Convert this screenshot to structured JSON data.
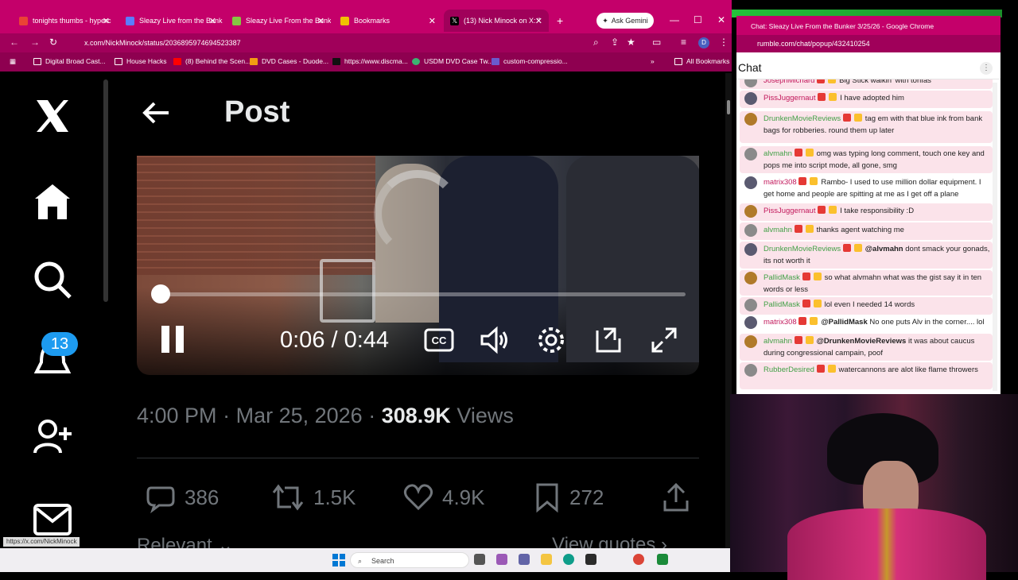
{
  "browser": {
    "tabs": [
      {
        "label": "tonights thumbs - hyperc",
        "color": "#ea4335"
      },
      {
        "label": "Sleazy Live from the Bunk",
        "color": "#5b7cff"
      },
      {
        "label": "Sleazy Live From the Bunk",
        "color": "#85c742"
      },
      {
        "label": "Bookmarks",
        "color": "#f0c000"
      },
      {
        "label": "(13) Nick Minock on X: \" ‪",
        "color": "#000000"
      }
    ],
    "ask_gemini": "Ask Gemini",
    "url": "x.com/NickMinock/status/2036895974694523387",
    "bookmarks": [
      "Digital Broad Cast...",
      "House Hacks",
      "(8) Behind the Scen...",
      "DVD Cases - Duode...",
      "https://www.discma...",
      "USDM DVD Case Tw...",
      "custom-compressio..."
    ],
    "all_bookmarks": "All Bookmarks",
    "status_url": "https://x.com/NickMinock"
  },
  "x": {
    "notifications_count": "13",
    "page_title": "Post",
    "video": {
      "time": "0:06 / 0:44",
      "progress": 0.14
    },
    "meta": {
      "time": "4:00 PM",
      "sep1": "·",
      "date": "Mar 25, 2026",
      "sep2": "·",
      "views": "308.9K",
      "views_label": "Views"
    },
    "actions": {
      "replies": "386",
      "reposts": "1.5K",
      "likes": "4.9K",
      "bookmarks": "272"
    },
    "relevant": "Relevant ⌄",
    "view_quotes": "View quotes ›"
  },
  "taskbar": {
    "search_placeholder": "Search"
  },
  "chat": {
    "window_title": "Chat: Sleazy Live From the Bunker 3/25/26 - Google Chrome",
    "url": "rumble.com/chat/popup/432410254",
    "title": "Chat",
    "messages": [
      {
        "user": "JosephMichard",
        "text": "Big Stick walkin' with tonfas",
        "user_color": "#c2185b",
        "highlight": true
      },
      {
        "user": "PissJuggernaut",
        "text": "I have adopted him",
        "user_color": "#c2185b",
        "highlight": true
      },
      {
        "user": "DrunkenMovieReviews",
        "text": "tag em with that blue ink from bank bags for robberies. round them up later",
        "user_color": "#43a047",
        "highlight": true
      },
      {
        "user": "alvmahn",
        "text": "omg was typing long comment, touch one key and pops me into script mode, all gone, smg",
        "user_color": "#43a047",
        "highlight": true
      },
      {
        "user": "matrix308",
        "text": "Rambo- I used to use million dollar equipment. I get home and people are spitting at me as I get off a plane",
        "user_color": "#c2185b",
        "highlight": false
      },
      {
        "user": "PissJuggernaut",
        "text": "I take responsibility :D",
        "user_color": "#c2185b",
        "highlight": true
      },
      {
        "user": "alvmahn",
        "text": "thanks agent watching me",
        "user_color": "#43a047",
        "highlight": true
      },
      {
        "user": "DrunkenMovieReviews",
        "mention": "@alvmahn",
        "text": "dont smack your gonads, its not worth it",
        "user_color": "#43a047",
        "highlight": true
      },
      {
        "user": "PallidMask",
        "text": "so what alvmahn what was the gist say it in ten words or less",
        "user_color": "#43a047",
        "highlight": true
      },
      {
        "user": "PallidMask",
        "text": "lol even I needed 14 words",
        "user_color": "#43a047",
        "highlight": true
      },
      {
        "user": "matrix308",
        "mention": "@PallidMask",
        "text": "No one puts Alv in the corner.... lol",
        "user_color": "#c2185b",
        "highlight": false
      },
      {
        "user": "alvmahn",
        "mention": "@DrunkenMovieReviews",
        "text": "it was about caucus during congressional campain, poof",
        "user_color": "#43a047",
        "highlight": true
      },
      {
        "user": "RubberDesired",
        "text": "watercannons are alot like flame throwers",
        "user_color": "#43a047",
        "highlight": true
      }
    ]
  },
  "colors": {
    "tab_bg": "#c4006a",
    "x_blue": "#1d9bf0",
    "chat_highlight": "#fbe3ea"
  }
}
